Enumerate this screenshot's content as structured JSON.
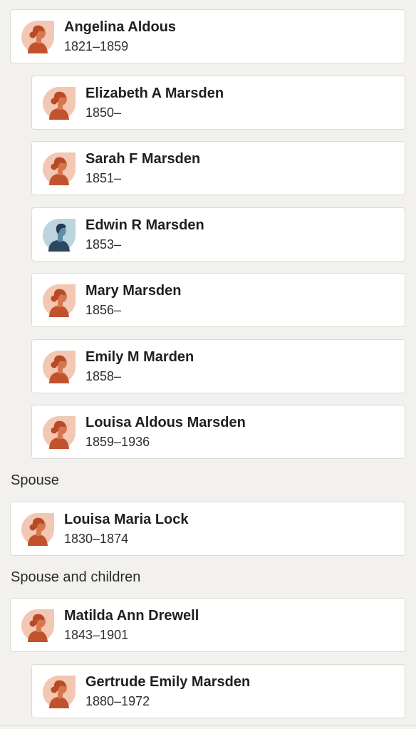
{
  "people": [
    {
      "name": "Angelina Aldous",
      "dates": "1821–1859",
      "gender": "female"
    },
    {
      "name": "Elizabeth A Marsden",
      "dates": "1850–",
      "gender": "female"
    },
    {
      "name": "Sarah F Marsden",
      "dates": "1851–",
      "gender": "female"
    },
    {
      "name": "Edwin R Marsden",
      "dates": "1853–",
      "gender": "male"
    },
    {
      "name": "Mary Marsden",
      "dates": "1856–",
      "gender": "female"
    },
    {
      "name": "Emily M Marden",
      "dates": "1858–",
      "gender": "female"
    },
    {
      "name": "Louisa Aldous Marsden",
      "dates": "1859–1936",
      "gender": "female"
    },
    {
      "name": "Louisa Maria Lock",
      "dates": "1830–1874",
      "gender": "female"
    },
    {
      "name": "Matilda Ann Drewell",
      "dates": "1843–1901",
      "gender": "female"
    },
    {
      "name": "Gertrude Emily Marsden",
      "dates": "1880–1972",
      "gender": "female"
    }
  ],
  "sections": {
    "spouse": "Spouse",
    "spouse_and_children": "Spouse and children"
  },
  "icons": {
    "female": "female-avatar-icon",
    "male": "male-avatar-icon"
  },
  "colors": {
    "background": "#f2f1ed",
    "card": "#ffffff",
    "female_avatar_bg": "#f2c7b3",
    "female_avatar_fg": "#c0532d",
    "male_avatar_bg": "#bcd3e0",
    "male_avatar_fg": "#2e4660"
  }
}
